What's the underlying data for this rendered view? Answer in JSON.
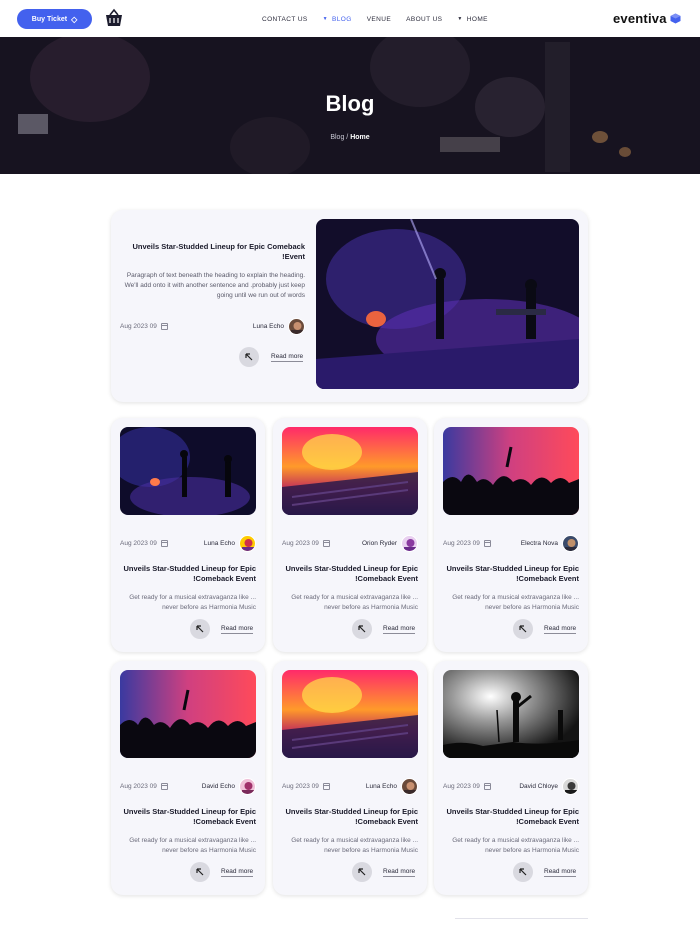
{
  "header": {
    "buy_ticket_label": "Buy Ticket",
    "nav": [
      {
        "label": "CONTACT US",
        "has_caret": false,
        "active": false
      },
      {
        "label": "BLOG",
        "has_caret": true,
        "active": true
      },
      {
        "label": "VENUE",
        "has_caret": false,
        "active": false
      },
      {
        "label": "ABOUT US",
        "has_caret": false,
        "active": false
      },
      {
        "label": "HOME",
        "has_caret": true,
        "active": false
      }
    ],
    "logo_text": "eventiva"
  },
  "hero": {
    "title": "Blog",
    "breadcrumb_parent": "Blog",
    "breadcrumb_separator": "/",
    "breadcrumb_current": "Home"
  },
  "featured": {
    "title": "Unveils Star-Studded Lineup for Epic Comeback !Event",
    "paragraph": "Paragraph of text beneath the heading to explain the heading. We'll add onto it with another sentence and .probably just keep going until we run out of words",
    "date": "Aug 2023 09",
    "author": "Luna Echo",
    "read_more": "Read more"
  },
  "cards": [
    {
      "date": "Aug 2023 09",
      "author": "Luna Echo",
      "title": "Unveils Star-Studded Lineup for Epic !Comeback Event",
      "excerpt": "Get ready for a musical extravaganza like ... never before as Harmonia Music",
      "read_more": "Read more"
    },
    {
      "date": "Aug 2023 09",
      "author": "Orion Ryder",
      "title": "Unveils Star-Studded Lineup for Epic !Comeback Event",
      "excerpt": "Get ready for a musical extravaganza like ... never before as Harmonia Music",
      "read_more": "Read more"
    },
    {
      "date": "Aug 2023 09",
      "author": "Electra Nova",
      "title": "Unveils Star-Studded Lineup for Epic !Comeback Event",
      "excerpt": "Get ready for a musical extravaganza like ... never before as Harmonia Music",
      "read_more": "Read more"
    },
    {
      "date": "Aug 2023 09",
      "author": "David Echo",
      "title": "Unveils Star-Studded Lineup for Epic !Comeback Event",
      "excerpt": "Get ready for a musical extravaganza like ... never before as Harmonia Music",
      "read_more": "Read more"
    },
    {
      "date": "Aug 2023 09",
      "author": "Luna Echo",
      "title": "Unveils Star-Studded Lineup for Epic !Comeback Event",
      "excerpt": "Get ready for a musical extravaganza like ... never before as Harmonia Music",
      "read_more": "Read more"
    },
    {
      "date": "Aug 2023 09",
      "author": "David Chloye",
      "title": "Unveils Star-Studded Lineup for Epic !Comeback Event",
      "excerpt": "Get ready for a musical extravaganza like ... never before as Harmonia Music",
      "read_more": "Read more"
    }
  ],
  "colors": {
    "accent": "#4361ee",
    "card_bg": "#f6f6fb"
  },
  "icons": {
    "ticket": "ticket-icon",
    "basket": "basket-icon",
    "calendar": "calendar-icon",
    "arrow": "arrow-up-left-icon",
    "logo": "cube-logo-icon"
  }
}
